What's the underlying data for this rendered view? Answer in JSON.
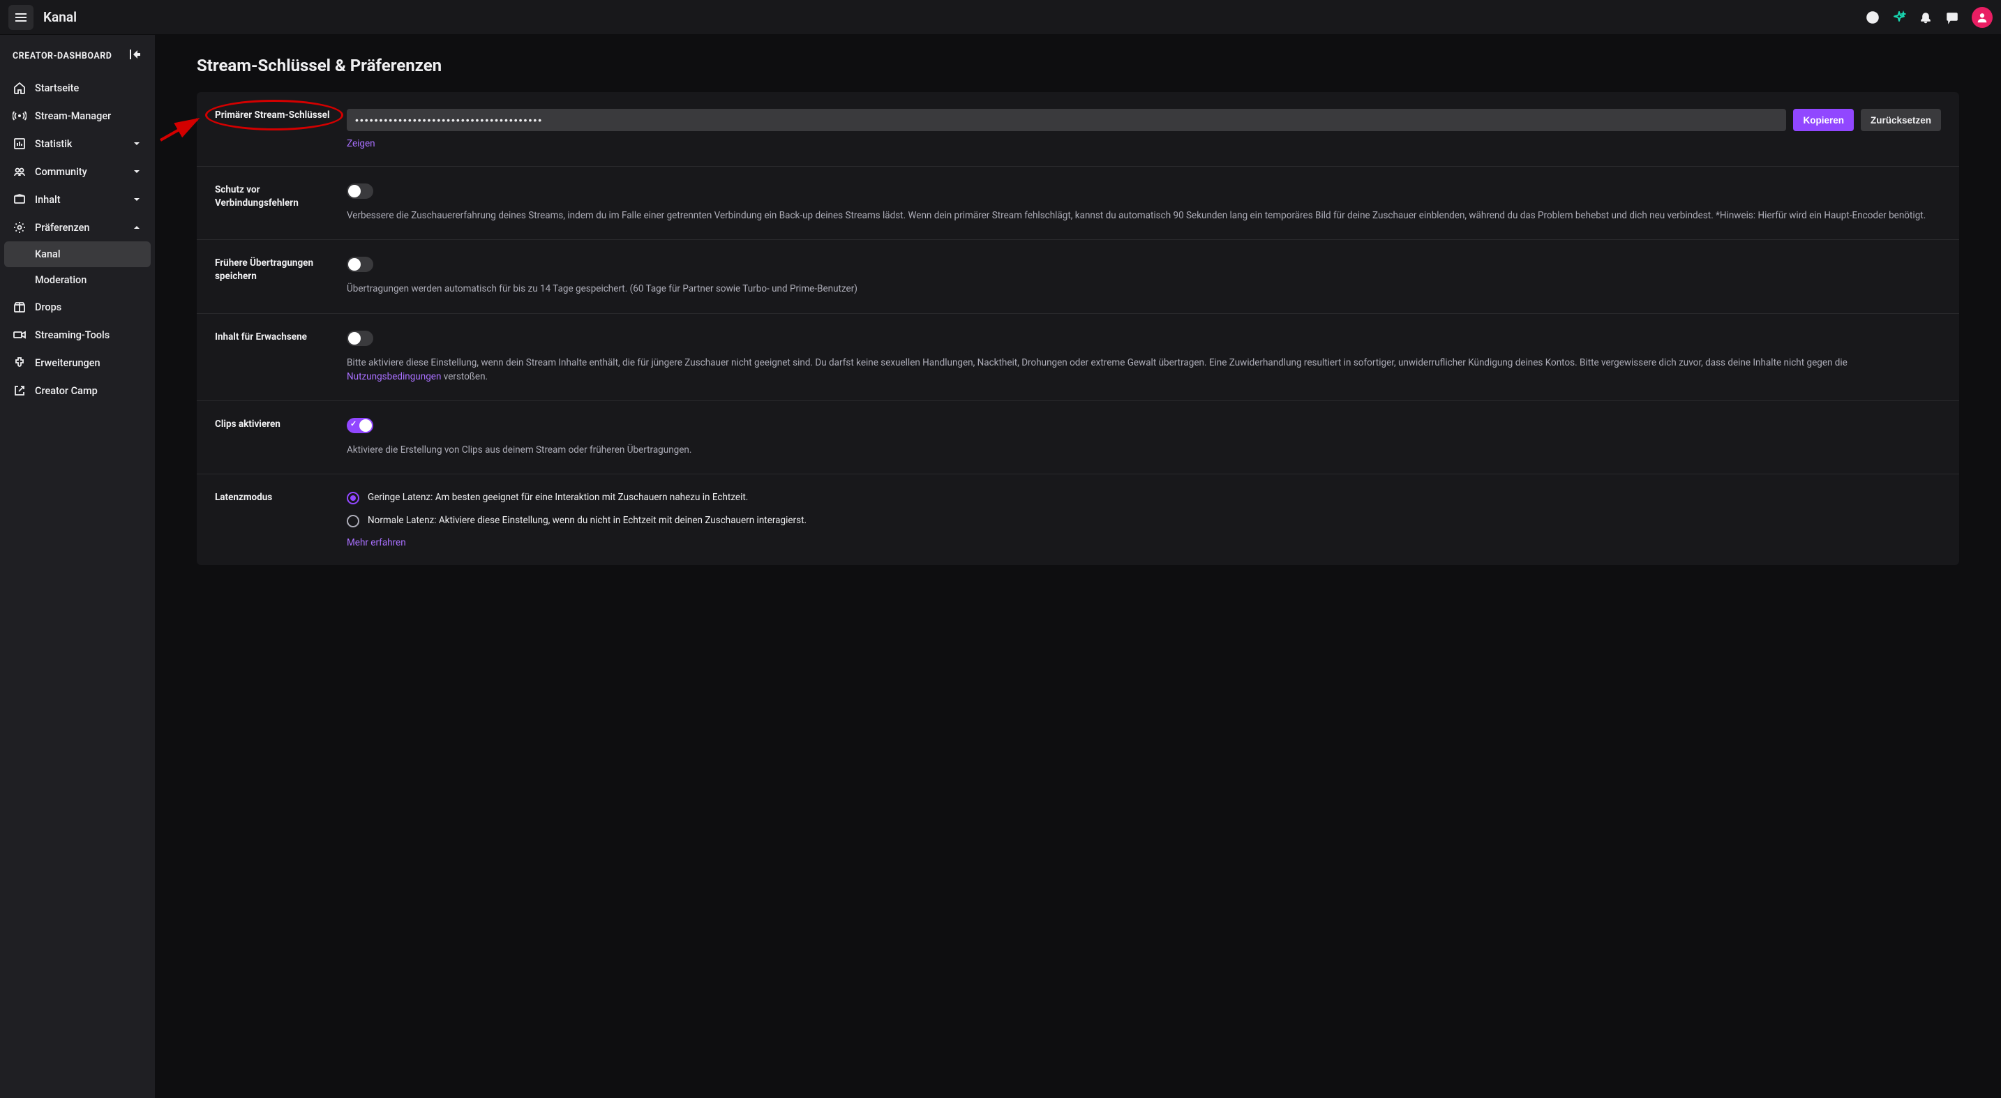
{
  "topbar": {
    "title": "Kanal"
  },
  "sidebar": {
    "header": "CREATOR-DASHBOARD",
    "items": {
      "home": "Startseite",
      "stream_manager": "Stream-Manager",
      "stats": "Statistik",
      "community": "Community",
      "content": "Inhalt",
      "prefs": "Präferenzen",
      "prefs_channel": "Kanal",
      "prefs_moderation": "Moderation",
      "drops": "Drops",
      "streaming_tools": "Streaming-Tools",
      "extensions": "Erweiterungen",
      "creator_camp": "Creator Camp"
    }
  },
  "main": {
    "title": "Stream-Schlüssel & Präferenzen",
    "stream_key": {
      "label": "Primärer Stream-Schlüssel",
      "value": "•••••••••••••••••••••••••••••••••••••••",
      "copy": "Kopieren",
      "reset": "Zurücksetzen",
      "show": "Zeigen"
    },
    "disconnect_protection": {
      "label": "Schutz vor Verbindungsfehlern",
      "desc": "Verbessere die Zuschauererfahrung deines Streams, indem du im Falle einer getrennten Verbindung ein Back-up deines Streams lädst. Wenn dein primärer Stream fehlschlägt, kannst du automatisch 90 Sekunden lang ein temporäres Bild für deine Zuschauer einblenden, während du das Problem behebst und dich neu verbindest. *Hinweis: Hierfür wird ein Haupt-Encoder benötigt."
    },
    "store_past": {
      "label": "Frühere Übertragungen speichern",
      "desc": "Übertragungen werden automatisch für bis zu 14 Tage gespeichert. (60 Tage für Partner sowie Turbo- und Prime-Benutzer)"
    },
    "mature": {
      "label": "Inhalt für Erwachsene",
      "desc_pre": "Bitte aktiviere diese Einstellung, wenn dein Stream Inhalte enthält, die für jüngere Zuschauer nicht geeignet sind. Du darfst keine sexuellen Handlungen, Nacktheit, Drohungen oder extreme Gewalt übertragen. Eine Zuwiderhandlung resultiert in sofortiger, unwiderruflicher Kündigung deines Kontos. Bitte vergewissere dich zuvor, dass deine Inhalte nicht gegen die ",
      "tos": "Nutzungsbedingungen",
      "desc_post": " verstoßen."
    },
    "clips": {
      "label": "Clips aktivieren",
      "desc": "Aktiviere die Erstellung von Clips aus deinem Stream oder früheren Übertragungen."
    },
    "latency": {
      "label": "Latenzmodus",
      "low": "Geringe Latenz: Am besten geeignet für eine Interaktion mit Zuschauern nahezu in Echtzeit.",
      "normal": "Normale Latenz: Aktiviere diese Einstellung, wenn du nicht in Echtzeit mit deinen Zuschauern interagierst.",
      "learn_more": "Mehr erfahren"
    }
  }
}
